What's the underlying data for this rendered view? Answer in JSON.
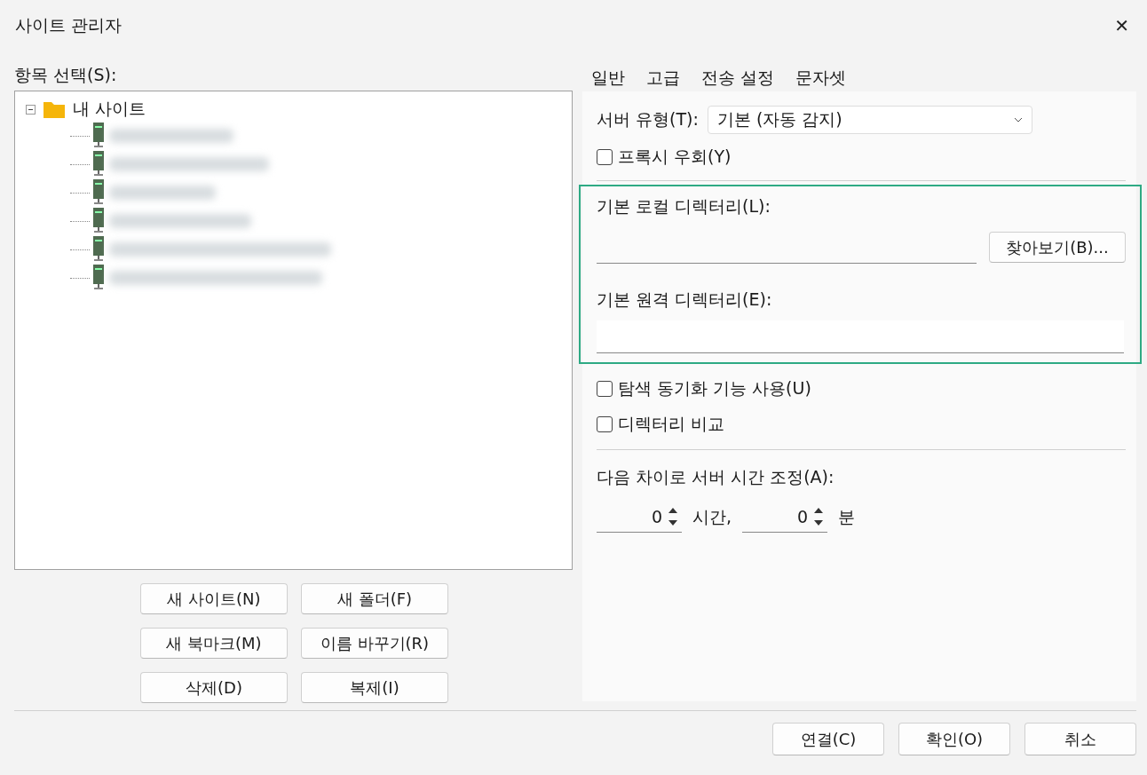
{
  "window": {
    "title": "사이트 관리자",
    "close": "✕"
  },
  "tree": {
    "label": "항목 선택(S):",
    "root": {
      "label": "내 사이트",
      "expanded": true,
      "children": [
        {
          "kind": "server"
        },
        {
          "kind": "server"
        },
        {
          "kind": "server"
        },
        {
          "kind": "server"
        },
        {
          "kind": "server"
        },
        {
          "kind": "server"
        }
      ]
    }
  },
  "tree_buttons": [
    "새 사이트(N)",
    "새 폴더(F)",
    "새 북마크(M)",
    "이름 바꾸기(R)",
    "삭제(D)",
    "복제(I)"
  ],
  "tabs": [
    {
      "label": "일반"
    },
    {
      "label": "고급"
    },
    {
      "label": "전송 설정"
    },
    {
      "label": "문자셋"
    }
  ],
  "server_type": {
    "label": "서버 유형(T):",
    "value": "기본 (자동 감지)"
  },
  "bypass_proxy": {
    "label": "프록시 우회(Y)",
    "checked": false
  },
  "local_dir": {
    "label": "기본 로컬 디렉터리(L):",
    "browse": "찾아보기(B)..."
  },
  "remote_dir": {
    "label": "기본 원격 디렉터리(E):"
  },
  "sync_browsing": {
    "label": "탐색 동기화 기능 사용(U)",
    "checked": false
  },
  "compare_dirs": {
    "label": "디렉터리 비교",
    "checked": false
  },
  "time_offset": {
    "label": "다음 차이로 서버 시간 조정(A):",
    "hours": "0",
    "hours_unit": "시간,",
    "minutes": "0",
    "minutes_unit": "분"
  },
  "footer_buttons": [
    "연결(C)",
    "확인(O)",
    "취소"
  ]
}
